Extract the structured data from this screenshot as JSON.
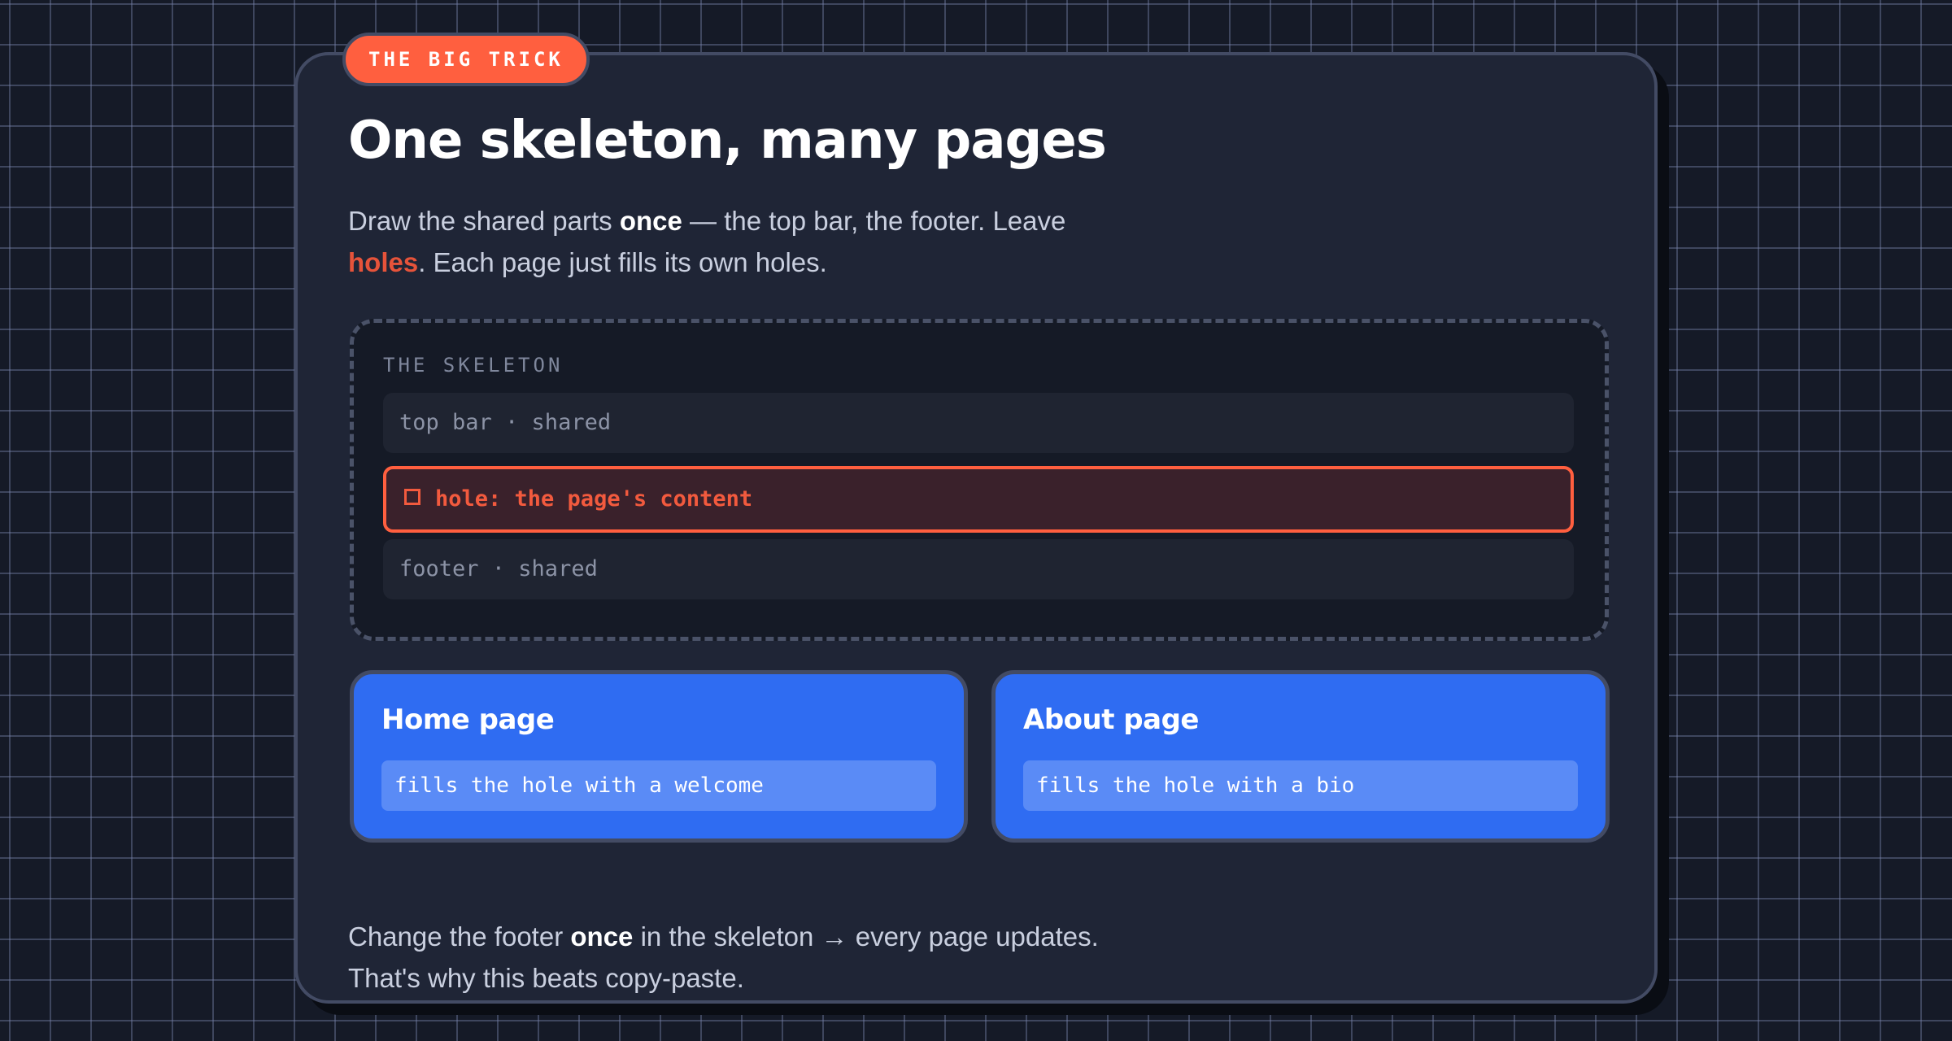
{
  "badge": "THE BIG TRICK",
  "title": "One skeleton, many pages",
  "lead": {
    "part1": "Draw the shared parts ",
    "once": "once",
    "part2": " — the top bar, the footer. Leave ",
    "holes": "holes",
    "part3": ". Each page just fills its own holes."
  },
  "skeleton": {
    "label": "THE SKELETON",
    "top_bar": "top bar · shared",
    "hole": "hole: the page's content",
    "footer": "footer · shared"
  },
  "pages": [
    {
      "title": "Home page",
      "fill": "fills the hole with a welcome"
    },
    {
      "title": "About page",
      "fill": "fills the hole with a bio"
    }
  ],
  "footnote": {
    "part1": "Change the footer ",
    "once": "once",
    "part2": " in the skeleton → every page updates.",
    "line2": "That's why this beats copy-paste."
  },
  "colors": {
    "accent": "#ff5f3f",
    "page_blue": "#2f6cf2",
    "card_bg": "#1f2536"
  }
}
